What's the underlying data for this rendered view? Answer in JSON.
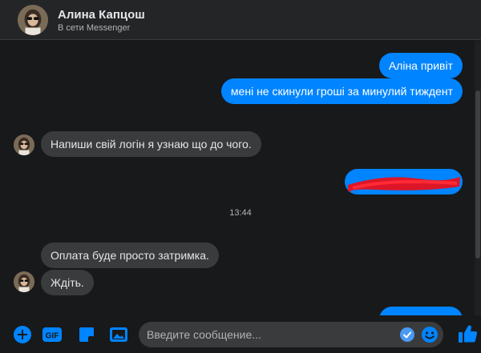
{
  "contact": {
    "name": "Алина Капцош",
    "status": "В сети Messenger"
  },
  "messages": [
    {
      "dir": "out",
      "text": "Аліна привіт"
    },
    {
      "dir": "out",
      "text": "мені не скинули гроші за минулий тиждент"
    },
    {
      "dir": "in",
      "text": "Напиши свій логін я узнаю що до чого."
    },
    {
      "dir": "out",
      "text": "",
      "redacted": true
    },
    {
      "dir": "in",
      "text": "Оплата буде просто затримка."
    },
    {
      "dir": "in",
      "text": "Ждіть."
    }
  ],
  "timestamp": "13:44",
  "composer": {
    "placeholder": "Введите сообщение...",
    "tools": [
      "plus-icon",
      "gif-icon",
      "sticker-icon",
      "image-icon"
    ],
    "gif_label": "GIF"
  },
  "colors": {
    "accent": "#0084ff",
    "background": "#18191a",
    "incoming_bubble": "#3a3b3c",
    "redaction": "#e8101e"
  }
}
